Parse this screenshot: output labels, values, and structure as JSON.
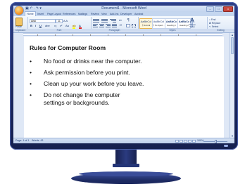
{
  "window": {
    "title": "Document1 - Microsoft Word",
    "qat": "▣ ↶ · ↷ ▾",
    "controls": {
      "min": "–",
      "max": "□",
      "close": "x"
    }
  },
  "ribbon": {
    "tabs": [
      "Home",
      "Insert",
      "Page Layout",
      "References",
      "Mailings",
      "Review",
      "View",
      "Add-Ins",
      "Developer",
      "Acrobat"
    ],
    "active_tab": "Home",
    "groups": {
      "clipboard": {
        "label": "Clipboard",
        "paste_label": "Paste"
      },
      "font": {
        "label": "Font",
        "font_name": "Arial",
        "font_size": "11",
        "bold": "B",
        "italic": "I",
        "underline": "U"
      },
      "paragraph": {
        "label": "Paragraph"
      },
      "styles": {
        "label": "Styles",
        "tiles": [
          {
            "sample": "AaBbCcI",
            "name": "¶ Normal"
          },
          {
            "sample": "AaBbCcI",
            "name": "¶ No Spaci..."
          },
          {
            "sample": "AaBbCc",
            "name": "Heading 1"
          },
          {
            "sample": "AaBbCc",
            "name": "Heading 2"
          }
        ],
        "change_styles": "Change Styles"
      },
      "editing": {
        "label": "Editing",
        "find": "Find",
        "replace": "Replace",
        "select": "Select"
      }
    }
  },
  "document": {
    "heading": "Rules for Computer Room",
    "bullet": "•",
    "rules": [
      "No food or drinks near the computer.",
      "Ask permission before you print.",
      "Clean up your work before you leave.",
      "Do not change the computer settings or backgrounds."
    ]
  },
  "status_bar": {
    "page": "Page: 1 of 1",
    "words": "Words: 43",
    "zoom": "100%",
    "zoom_fraction": 0.5
  },
  "colors": {
    "monitor": "#1d2a63",
    "ribbon_bg": "#dde8f6",
    "page_bg": "#ffffff"
  }
}
